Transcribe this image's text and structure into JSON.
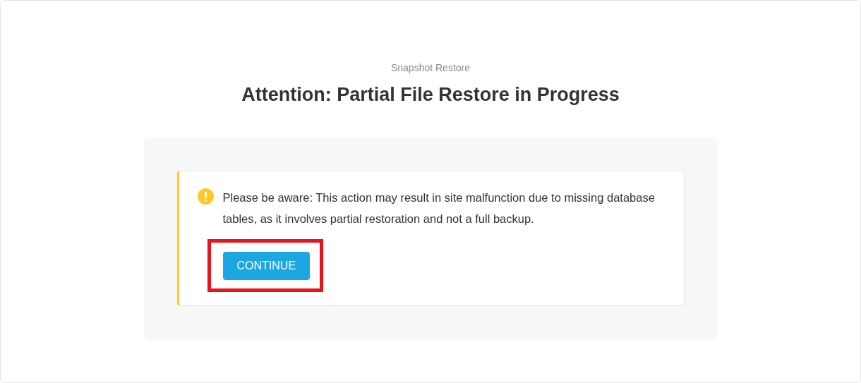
{
  "header": {
    "eyebrow": "Snapshot Restore",
    "title": "Attention: Partial File Restore in Progress"
  },
  "notice": {
    "kind": "warning",
    "message": "Please be aware: This action may result in site malfunction due to missing database tables, as it involves partial restoration and not a full backup.",
    "button": {
      "label": "CONTINUE",
      "highlighted": true
    }
  }
}
